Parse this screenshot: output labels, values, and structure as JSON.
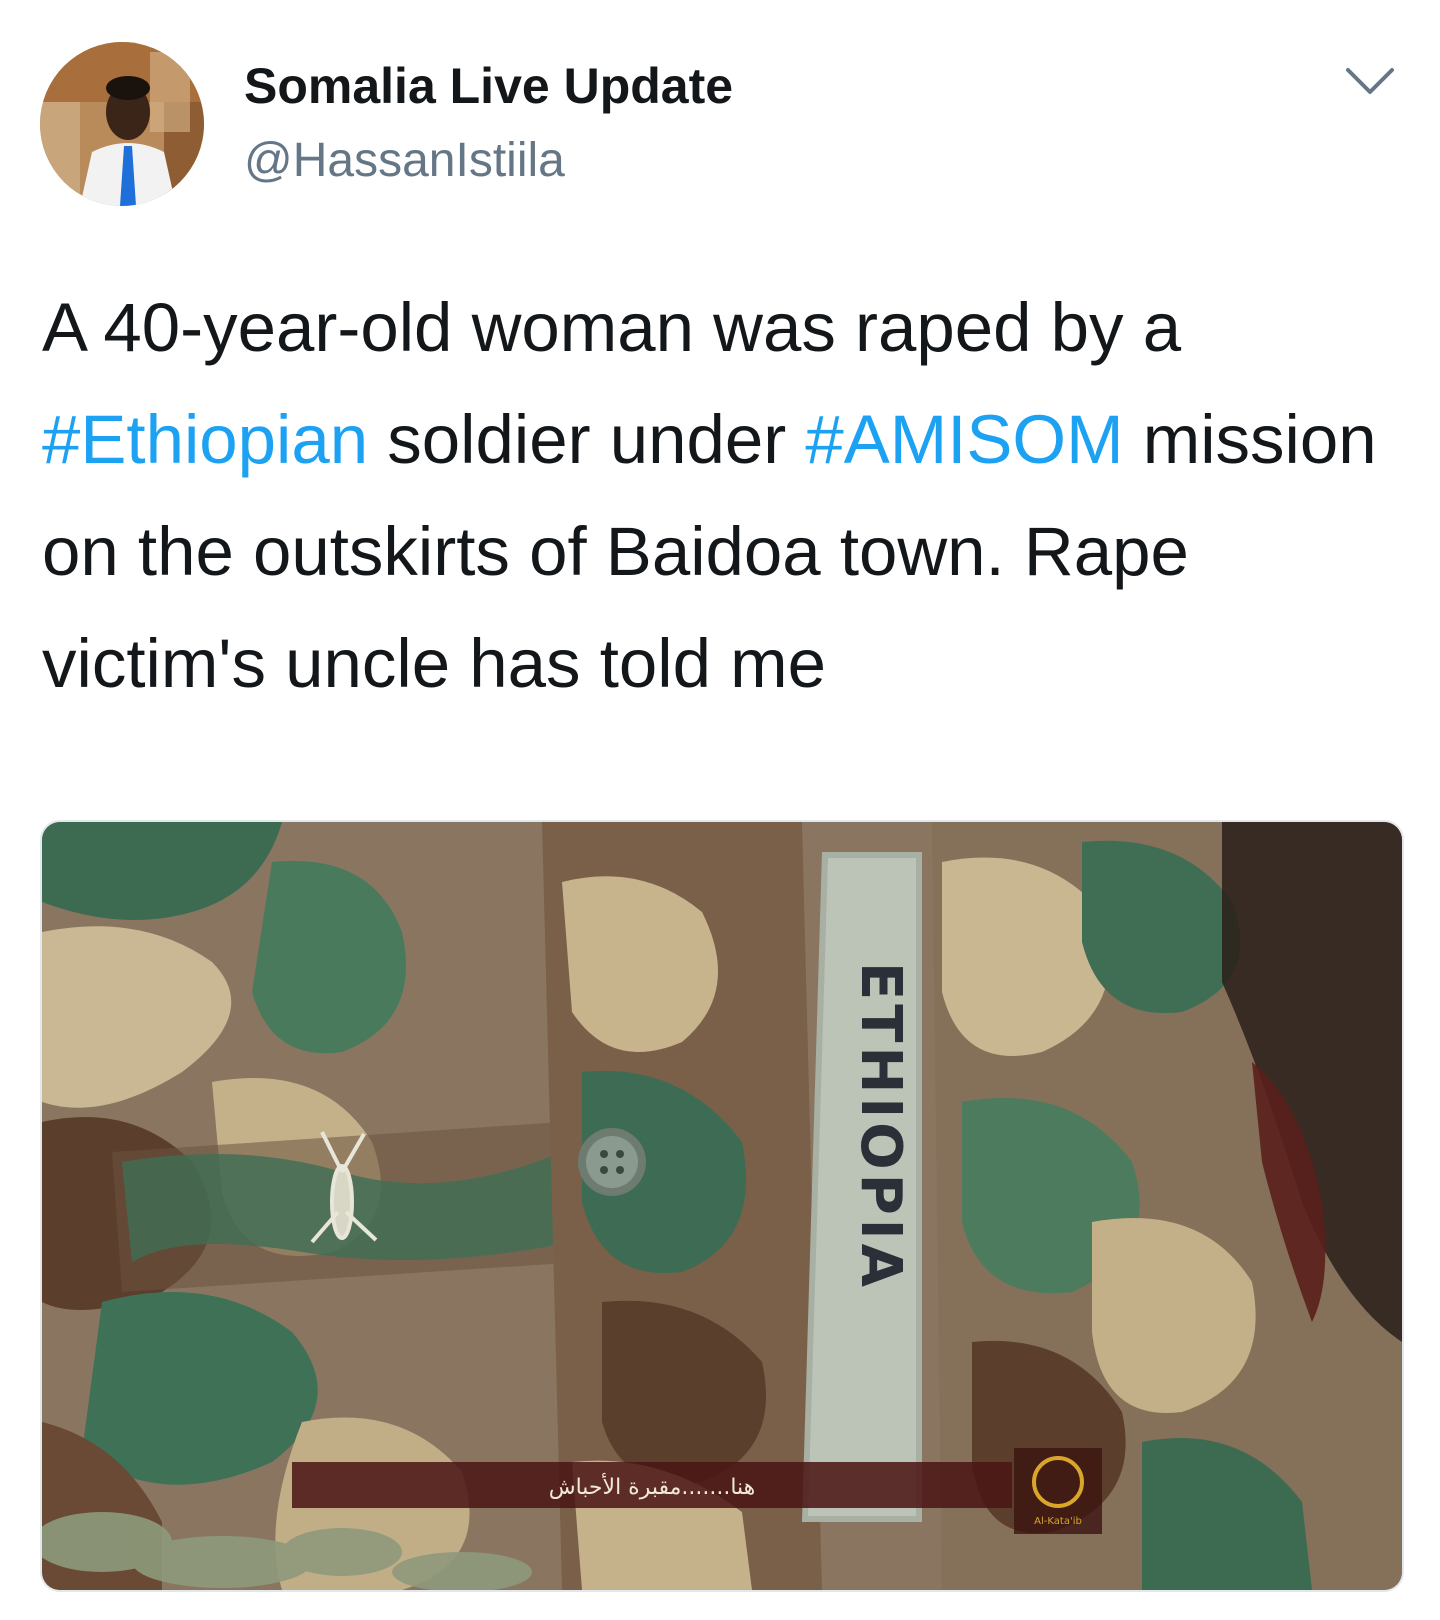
{
  "tweet": {
    "author": {
      "display_name": "Somalia Live Update",
      "handle": "@HassanIstiila"
    },
    "text_segments": [
      {
        "text": "A 40-year-old woman was raped by a ",
        "hashtag": false
      },
      {
        "text": "#Ethiopian",
        "hashtag": true
      },
      {
        "text": " soldier under ",
        "hashtag": false
      },
      {
        "text": "#AMISOM",
        "hashtag": true
      },
      {
        "text": " mission on the outskirts of Baidoa town. Rape victim's uncle has told me",
        "hashtag": false
      }
    ],
    "media": {
      "tape_text": "ETHIOPIA",
      "caption_text": "هنا.......مقبرة الأحباش",
      "logo_text": "Al-Kata'ib"
    }
  },
  "colors": {
    "text": "#14171a",
    "secondary": "#657786",
    "link": "#1da1f2",
    "border": "#e1e8ed"
  },
  "icons": {
    "menu": "chevron-down-icon"
  }
}
